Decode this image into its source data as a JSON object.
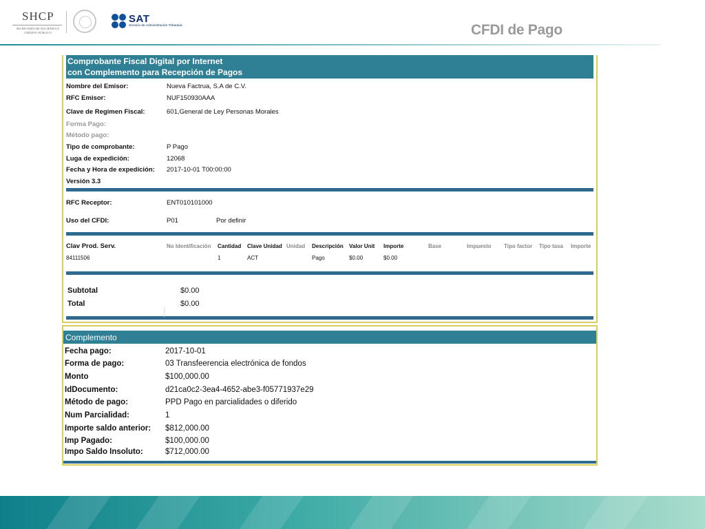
{
  "header": {
    "shcp_logo": "SHCP",
    "shcp_subtitle": "SECRETARÍA DE HACIENDA Y CRÉDITO PÚBLICO",
    "sat_logo": "SAT",
    "sat_subtitle": "Servicio de Administración Tributaria",
    "title": "CFDI de Pago"
  },
  "comprobante": {
    "title_line1": "Comprobante Fiscal Digital por Internet",
    "title_line2": "con Complemento para Recepción de Pagos",
    "fields": [
      {
        "label": "Nombre del Emisor:",
        "value": "Nueva Factrua, S.A de C.V.",
        "muted": false
      },
      {
        "label": "RFC Emisor:",
        "value": "NUF150930AAA",
        "muted": false
      },
      {
        "label": "Clave de Regimen Fiscal:",
        "value": "601,General de Ley Personas Morales",
        "muted": false
      },
      {
        "label": "Forma Pago:",
        "value": "",
        "muted": true
      },
      {
        "label": "Método pago:",
        "value": "",
        "muted": true
      },
      {
        "label": "Tipo de comprobante:",
        "value": "P  Pago",
        "muted": false
      },
      {
        "label": "Luga de expedición:",
        "value": "12068",
        "muted": false
      },
      {
        "label": "Fecha y Hora de expedición:",
        "value": "2017-10-01 T00:00:00",
        "muted": false
      },
      {
        "label": "Versión 3.3",
        "value": "",
        "muted": false
      }
    ],
    "receptor": {
      "rfc_label": "RFC Receptor:",
      "rfc_value": "ENT010101000",
      "uso_label": "Uso del CFDI:",
      "uso_code": "P01",
      "uso_desc": "Por definir"
    },
    "conceptos": {
      "headers": [
        "Clav Prod. Serv.",
        "No Identificación",
        "Cantidad",
        "Clave Unidad",
        "Unidad",
        "Descripción",
        "Valor Unit",
        "Importe",
        "Base",
        "Impuesto",
        "Tipo factor",
        "Tipo tasa",
        "Importe"
      ],
      "row": [
        "84111506",
        "",
        "1",
        "ACT",
        "",
        "Pago",
        "$0.00",
        "$0.00",
        "",
        "",
        "",
        "",
        ""
      ]
    },
    "totals": {
      "subtotal_label": "Subtotal",
      "subtotal_value": "$0.00",
      "total_label": "Total",
      "total_value": "$0.00"
    }
  },
  "complemento": {
    "title": "Complemento",
    "fields": [
      {
        "label": "Fecha pago:",
        "value": "2017-10-01"
      },
      {
        "label": "Forma de pago:",
        "value": "03 Transfeerencia electrónica de fondos"
      },
      {
        "label": "Monto",
        "value": "$100,000.00"
      },
      {
        "label": "IdDocumento:",
        "value": "d21ca0c2-3ea4-4652-abe3-f05771937e29"
      },
      {
        "label": "Método de pago:",
        "value": "PPD Pago en parcialidades o diferido"
      },
      {
        "label": "Num Parcialidad:",
        "value": "1"
      },
      {
        "label": "Importe saldo anterior:",
        "value": "$812,000.00"
      },
      {
        "label": "Imp Pagado:",
        "value": "$100,000.00"
      },
      {
        "label": "Impo Saldo Insoluto:",
        "value": "$712,000.00"
      }
    ]
  },
  "colors": {
    "section_header": "#2f7f95",
    "separator": "#2e6a8e",
    "border": "#d8cf5a",
    "footer": "#0f7f8a"
  }
}
